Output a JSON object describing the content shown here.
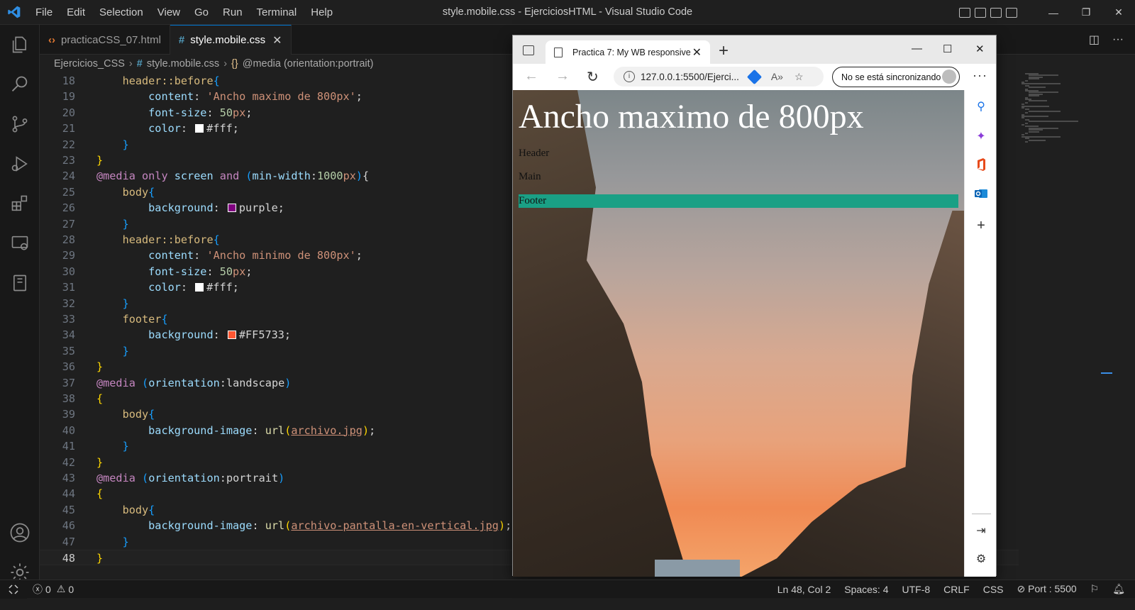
{
  "window": {
    "title": "style.mobile.css - EjerciciosHTML - Visual Studio Code",
    "menu": [
      "File",
      "Edit",
      "Selection",
      "View",
      "Go",
      "Run",
      "Terminal",
      "Help"
    ]
  },
  "tabs": [
    {
      "label": "practicaCSS_07.html",
      "icon": "html-icon",
      "active": false
    },
    {
      "label": "style.mobile.css",
      "icon": "css-hash-icon",
      "active": true
    }
  ],
  "breadcrumb": {
    "folder": "Ejercicios_CSS",
    "file": "style.mobile.css",
    "symbol": "@media (orientation:portrait)"
  },
  "editor": {
    "current_line": 48,
    "lines": [
      {
        "n": "18",
        "text": "    header::before{"
      },
      {
        "n": "19",
        "text": "        content: 'Ancho maximo de 800px';"
      },
      {
        "n": "20",
        "text": "        font-size: 50px;"
      },
      {
        "n": "21",
        "text": "        color: #fff;"
      },
      {
        "n": "22",
        "text": "    }"
      },
      {
        "n": "23",
        "text": "}"
      },
      {
        "n": "24",
        "text": "@media only screen and (min-width:1000px){"
      },
      {
        "n": "25",
        "text": "    body{"
      },
      {
        "n": "26",
        "text": "        background: purple;"
      },
      {
        "n": "27",
        "text": "    }"
      },
      {
        "n": "28",
        "text": "    header::before{"
      },
      {
        "n": "29",
        "text": "        content: 'Ancho minimo de 800px';"
      },
      {
        "n": "30",
        "text": "        font-size: 50px;"
      },
      {
        "n": "31",
        "text": "        color: #fff;"
      },
      {
        "n": "32",
        "text": "    }"
      },
      {
        "n": "33",
        "text": "    footer{"
      },
      {
        "n": "34",
        "text": "        background: #FF5733;"
      },
      {
        "n": "35",
        "text": "    }"
      },
      {
        "n": "36",
        "text": "}"
      },
      {
        "n": "37",
        "text": "@media (orientation:landscape)"
      },
      {
        "n": "38",
        "text": "{"
      },
      {
        "n": "39",
        "text": "    body{"
      },
      {
        "n": "40",
        "text": "        background-image: url(archivo.jpg);"
      },
      {
        "n": "41",
        "text": "    }"
      },
      {
        "n": "42",
        "text": "}"
      },
      {
        "n": "43",
        "text": "@media (orientation:portrait)"
      },
      {
        "n": "44",
        "text": "{"
      },
      {
        "n": "45",
        "text": "    body{"
      },
      {
        "n": "46",
        "text": "        background-image: url(archivo-pantalla-en-vertical.jpg);"
      },
      {
        "n": "47",
        "text": "    }"
      },
      {
        "n": "48",
        "text": "}"
      }
    ],
    "swatch_colors": {
      "white": "#ffffff",
      "purple": "#800080",
      "orange": "#FF5733"
    }
  },
  "statusbar": {
    "errors": "0",
    "warnings": "0",
    "position": "Ln 48, Col 2",
    "spaces": "Spaces: 4",
    "encoding": "UTF-8",
    "eol": "CRLF",
    "language": "CSS",
    "port": "Port : 5500"
  },
  "browser": {
    "tab_title": "Practica 7: My WB responsive",
    "url": "127.0.0.1:5500/Ejerci...",
    "sync_label": "No se está sincronizando",
    "page": {
      "heading": "Ancho maximo de 800px",
      "header": "Header",
      "main": "Main",
      "footer": "Footer",
      "footer_color": "#1aa085"
    }
  }
}
